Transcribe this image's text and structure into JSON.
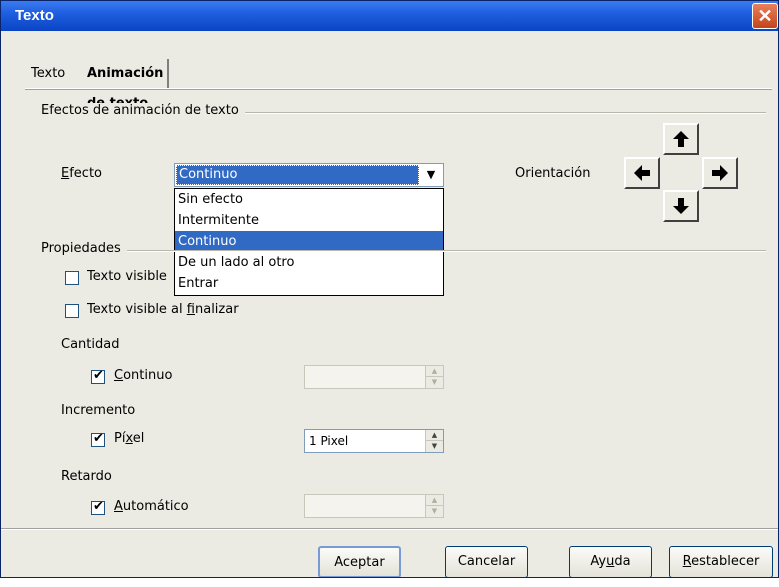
{
  "window": {
    "title": "Texto",
    "close_glyph": "✕"
  },
  "tabs": [
    {
      "label": "Texto",
      "active": false
    },
    {
      "label": "Animación de texto",
      "active": true
    }
  ],
  "animation": {
    "section_title": "Efectos de animación de texto",
    "effect_label_prefix": "",
    "effect_label_mnemonic": "E",
    "effect_label_rest": "fecto",
    "effect_value": "Continuo",
    "effect_options": [
      "Sin efecto",
      "Intermitente",
      "Continuo",
      "De un lado al otro",
      "Entrar"
    ],
    "orientation_label": "Orientación",
    "orientation_buttons": [
      "arrow-up-icon",
      "arrow-left-icon",
      "arrow-right-icon",
      "arrow-down-icon"
    ]
  },
  "properties": {
    "section_title": "Propiedades",
    "visible_start_label": "Texto visible",
    "visible_start_checked": false,
    "visible_end_label_a": "Texto visible al ",
    "visible_end_label_u": "f",
    "visible_end_label_b": "inalizar",
    "visible_end_checked": false,
    "cantidad_label": "Cantidad",
    "continuo_u": "C",
    "continuo_rest": "ontinuo",
    "continuo_checked": true,
    "cantidad_value": "",
    "incremento_label": "Incremento",
    "pixel_a": "Pí",
    "pixel_u": "x",
    "pixel_b": "el",
    "pixel_checked": true,
    "incremento_value": "1 Pixel",
    "retardo_label": "Retardo",
    "auto_u": "A",
    "auto_rest": "utomático",
    "auto_checked": true,
    "retardo_value": ""
  },
  "footer": {
    "accept": "Aceptar",
    "cancel": "Cancelar",
    "help_a": "Ay",
    "help_u": "u",
    "help_b": "da",
    "reset_u": "R",
    "reset_rest": "establecer"
  },
  "colors": {
    "titlebar": "#0a44c4",
    "selection": "#316ac5",
    "dialog_bg": "#ecebe3",
    "close_button": "#c2441a"
  }
}
